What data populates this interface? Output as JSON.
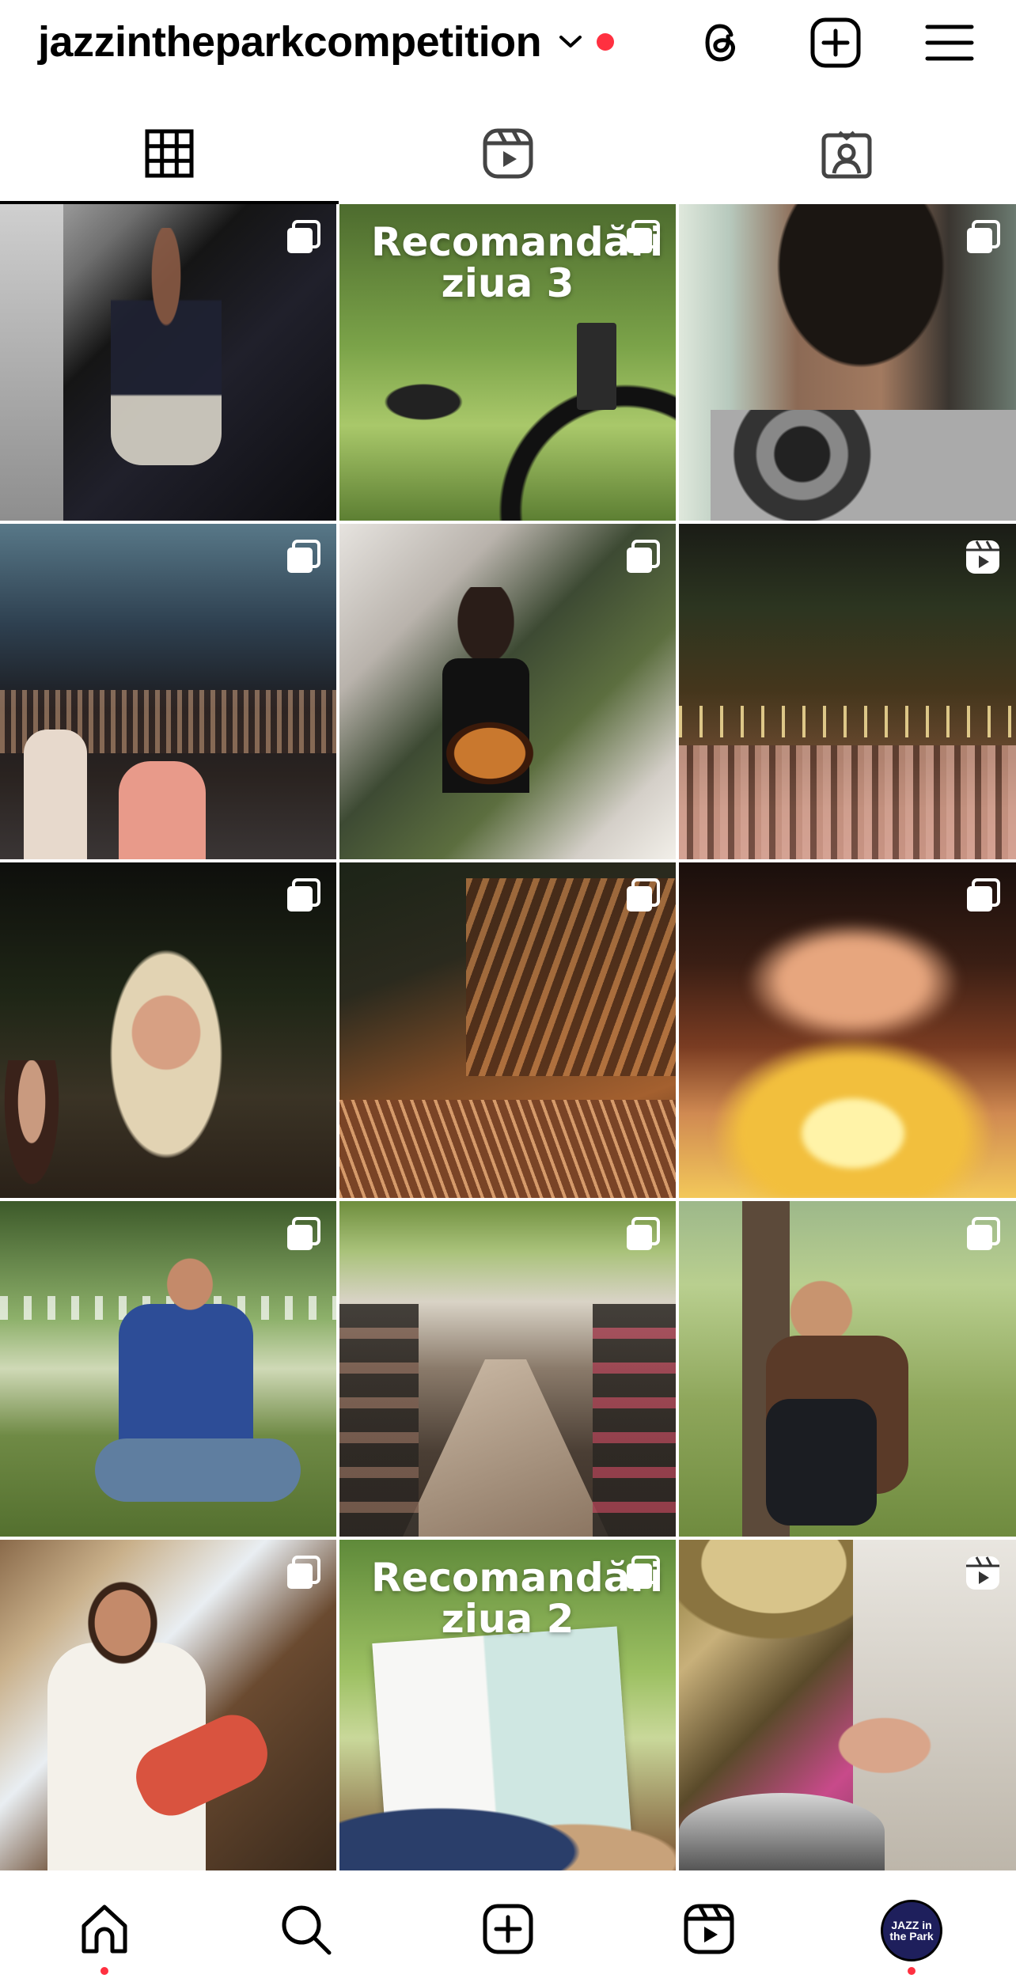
{
  "header": {
    "username": "jazzintheparkcompetition",
    "icons": [
      "chevron-down-icon",
      "threads-icon",
      "new-post-icon",
      "menu-icon"
    ],
    "notification_dot_color": "#ff3040"
  },
  "tabs": [
    {
      "icon": "grid-icon",
      "selected": true
    },
    {
      "icon": "reels-icon",
      "selected": false
    },
    {
      "icon": "tagged-icon",
      "selected": false
    }
  ],
  "posts": [
    {
      "type": "carousel",
      "overlay_text": ""
    },
    {
      "type": "carousel",
      "overlay_text": "Recomandări ziua 3"
    },
    {
      "type": "carousel",
      "overlay_text": ""
    },
    {
      "type": "carousel",
      "overlay_text": ""
    },
    {
      "type": "carousel",
      "overlay_text": ""
    },
    {
      "type": "reel",
      "overlay_text": ""
    },
    {
      "type": "carousel",
      "overlay_text": ""
    },
    {
      "type": "carousel",
      "overlay_text": ""
    },
    {
      "type": "carousel",
      "overlay_text": ""
    },
    {
      "type": "carousel",
      "overlay_text": ""
    },
    {
      "type": "carousel",
      "overlay_text": ""
    },
    {
      "type": "carousel",
      "overlay_text": ""
    },
    {
      "type": "carousel",
      "overlay_text": ""
    },
    {
      "type": "carousel",
      "overlay_text": "Recomandări ziua 2"
    },
    {
      "type": "reel",
      "overlay_text": ""
    }
  ],
  "bottom_nav": {
    "items": [
      "home-icon",
      "search-icon",
      "create-icon",
      "reels-icon",
      "profile-avatar"
    ],
    "avatar_text": "JAZZ in the Park"
  },
  "colors": {
    "accent_red": "#ff3040",
    "text": "#000000"
  }
}
